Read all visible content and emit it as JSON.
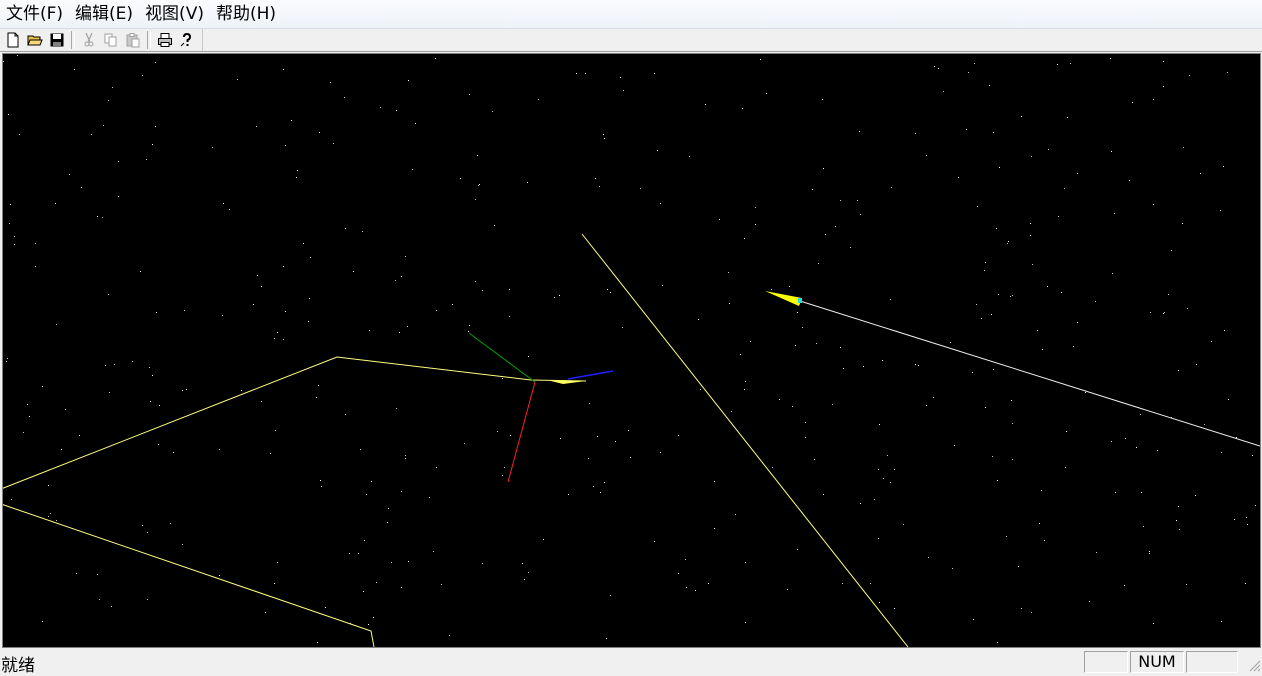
{
  "menubar": {
    "items": [
      "文件(F)",
      "编辑(E)",
      "视图(V)",
      "帮助(H)"
    ]
  },
  "toolbar": {
    "buttons": [
      {
        "icon": "new-file-icon",
        "enabled": true
      },
      {
        "icon": "open-folder-icon",
        "enabled": true
      },
      {
        "icon": "save-icon",
        "enabled": true
      },
      {
        "icon": "cut-icon",
        "enabled": false
      },
      {
        "icon": "copy-icon",
        "enabled": false
      },
      {
        "icon": "paste-icon",
        "enabled": false
      },
      {
        "icon": "print-icon",
        "enabled": true
      },
      {
        "icon": "help-icon",
        "enabled": true
      }
    ]
  },
  "viewport": {
    "background": "#000000",
    "line_color": "#ffff80",
    "axis_colors": {
      "x": "#00a000",
      "y": "#ff2020",
      "z": "#2020ff"
    }
  },
  "statusbar": {
    "text": "就绪",
    "panes": [
      "",
      "NUM",
      ""
    ]
  }
}
